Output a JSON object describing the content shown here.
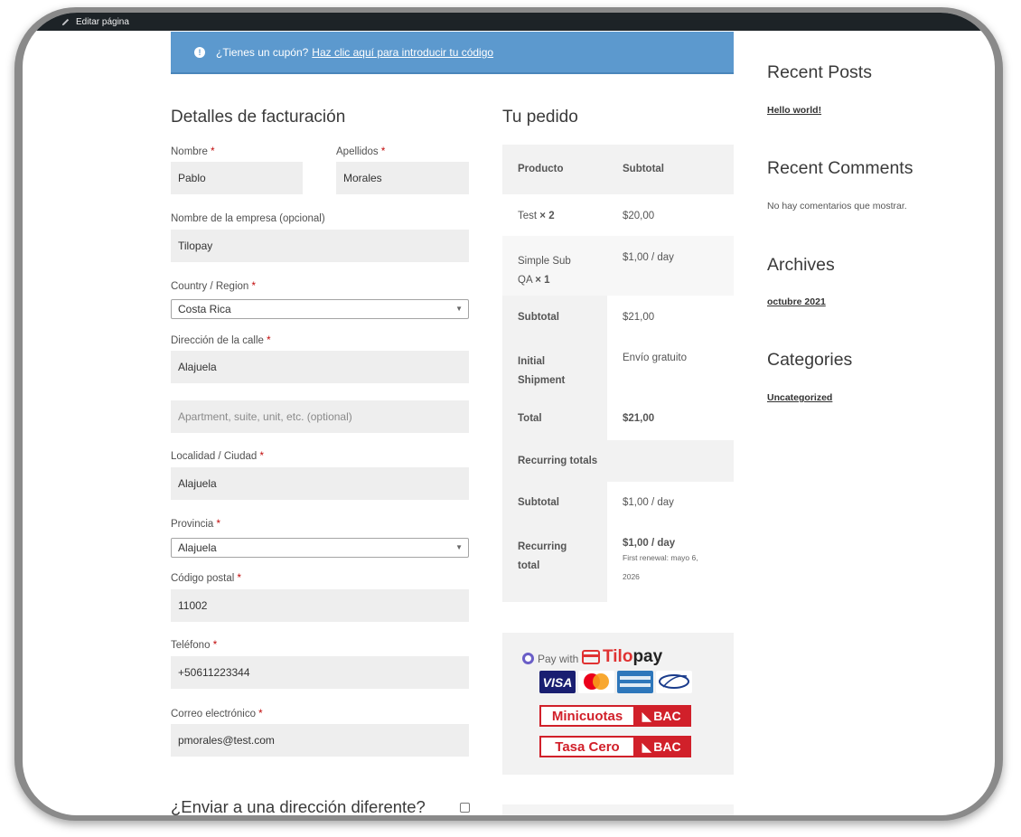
{
  "adminbar": {
    "edit_label": "Editar página"
  },
  "notice": {
    "text": "¿Tienes un cupón?",
    "link": "Haz clic aquí para introducir tu código"
  },
  "billing": {
    "title": "Detalles de facturación",
    "first_name": {
      "label": "Nombre",
      "value": "Pablo"
    },
    "last_name": {
      "label": "Apellidos",
      "value": "Morales"
    },
    "company": {
      "label": "Nombre de la empresa (opcional)",
      "value": "Tilopay"
    },
    "country": {
      "label": "Country / Region",
      "value": "Costa Rica"
    },
    "street": {
      "label": "Dirección de la calle",
      "value": "Alajuela"
    },
    "apartment": {
      "placeholder": "Apartment, suite, unit, etc. (optional)"
    },
    "city": {
      "label": "Localidad / Ciudad",
      "value": "Alajuela"
    },
    "province": {
      "label": "Provincia",
      "value": "Alajuela"
    },
    "postcode": {
      "label": "Código postal",
      "value": "11002"
    },
    "phone": {
      "label": "Teléfono",
      "value": "+50611223344"
    },
    "email": {
      "label": "Correo electrónico",
      "value": "pmorales@test.com"
    },
    "ship_different": "¿Enviar a una dirección diferente?",
    "required_mark": "*"
  },
  "order": {
    "title": "Tu pedido",
    "header": {
      "product": "Producto",
      "subtotal": "Subtotal"
    },
    "items": [
      {
        "name": "Test",
        "qty": "× 2",
        "price": "$20,00"
      },
      {
        "name_line1": "Simple Sub",
        "name_line2": "QA",
        "qty": "× 1",
        "price": "$1,00 / day"
      }
    ],
    "subtotal": {
      "label": "Subtotal",
      "value": "$21,00"
    },
    "shipment": {
      "label_line1": "Initial",
      "label_line2": "Shipment",
      "value": "Envío gratuito"
    },
    "total": {
      "label": "Total",
      "value": "$21,00"
    },
    "recurring_title": "Recurring totals",
    "recurring_subtotal": {
      "label": "Subtotal",
      "value": "$1,00 / day"
    },
    "recurring_total": {
      "label_line1": "Recurring",
      "label_line2": "total",
      "value": "$1,00 / day",
      "renewal_line1": "First renewal: mayo 6,",
      "renewal_line2": "2026"
    }
  },
  "payment": {
    "pay_with": "Pay with",
    "brand_a": "Tilo",
    "brand_b": "pay",
    "visa": "VISA",
    "minicuotas": "Minicuotas",
    "tasa_cero": "Tasa Cero",
    "bac": "BAC"
  },
  "sidebar": {
    "recent_posts_title": "Recent Posts",
    "recent_post_1": "Hello world!",
    "recent_comments_title": "Recent Comments",
    "no_comments": "No hay comentarios que mostrar.",
    "archives_title": "Archives",
    "archive_1": "octubre 2021",
    "categories_title": "Categories",
    "category_1": "Uncategorized"
  },
  "colors": {
    "notice_bg": "#5c99ce",
    "required": "#c10a0a",
    "bac_red": "#d1202a",
    "admin_bar": "#1d2327"
  }
}
